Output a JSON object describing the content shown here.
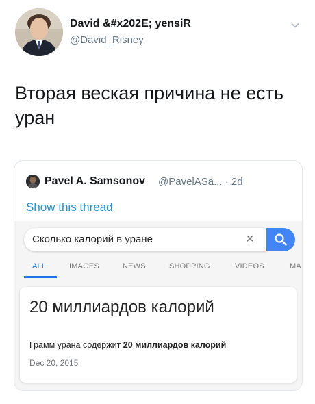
{
  "tweet": {
    "author": {
      "display_name": "David &#x202E; yensiR",
      "handle": "@David_Risney"
    },
    "text": "Вторая веская причина не есть уран"
  },
  "quoted_tweet": {
    "author": {
      "display_name": "Pavel A. Samsonov",
      "meta": "@PavelASa... · 2d"
    },
    "show_thread_label": "Show this thread",
    "search": {
      "query": "Сколько калорий в уране",
      "tabs": [
        {
          "label": "ALL",
          "active": true
        },
        {
          "label": "IMAGES"
        },
        {
          "label": "NEWS"
        },
        {
          "label": "SHOPPING"
        },
        {
          "label": "VIDEOS"
        },
        {
          "label": "MA"
        }
      ],
      "result": {
        "title": "20 миллиардов калорий",
        "snippet_prefix": "Грамм урана содержит ",
        "snippet_bold": "20 миллиардов калорий",
        "date": "Dec 20, 2015"
      }
    }
  },
  "colors": {
    "link": "#1b95e0",
    "google_blue": "#4285f4",
    "tab_active": "#1a73e8",
    "muted": "#657786"
  }
}
